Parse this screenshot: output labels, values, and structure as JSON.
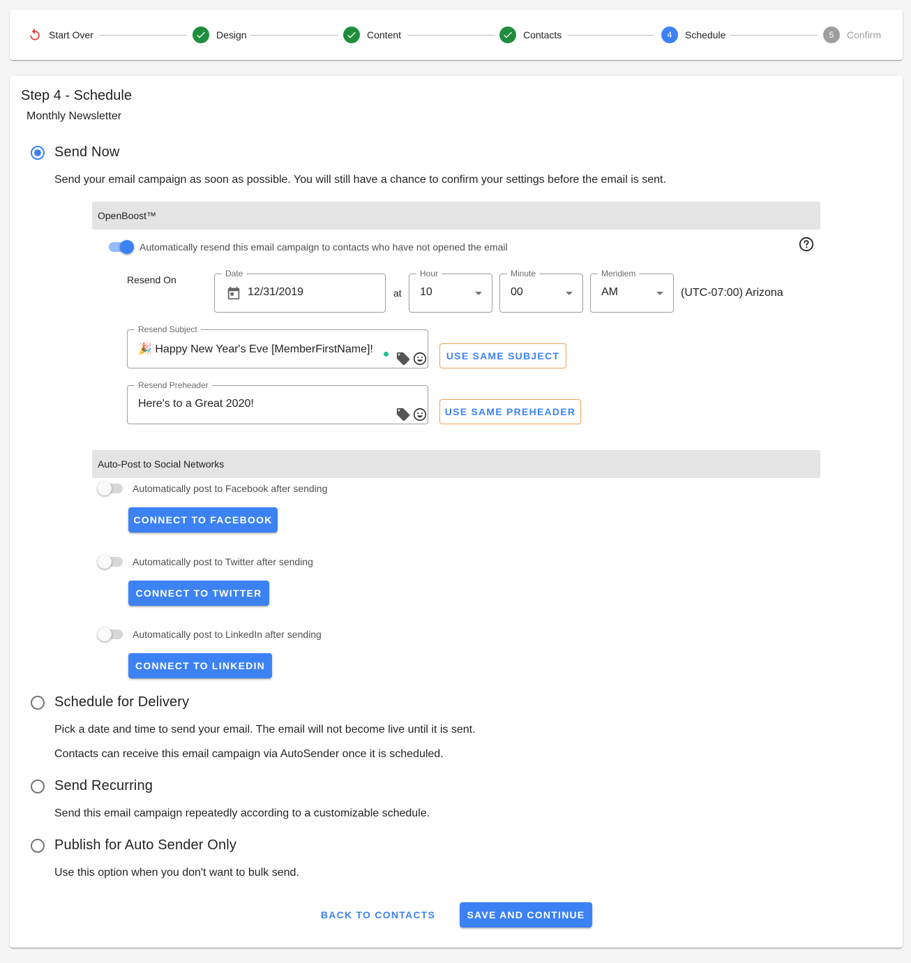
{
  "stepper": {
    "start_over": "Start Over",
    "steps": [
      {
        "label": "Design",
        "status": "done"
      },
      {
        "label": "Content",
        "status": "done"
      },
      {
        "label": "Contacts",
        "status": "done"
      },
      {
        "label": "Schedule",
        "number": "4",
        "status": "active"
      },
      {
        "label": "Confirm",
        "number": "5",
        "status": "future"
      }
    ]
  },
  "page": {
    "title": "Step 4 - Schedule",
    "subtitle": "Monthly Newsletter"
  },
  "options": {
    "send_now": {
      "title": "Send Now",
      "description": "Send your email campaign as soon as possible. You will still have a chance to confirm your settings before the email is sent.",
      "selected": true
    },
    "schedule": {
      "title": "Schedule for Delivery",
      "description": "Pick a date and time to send your email. The email will not become live until it is sent.",
      "description2": "Contacts can receive this email campaign via AutoSender once it is scheduled.",
      "selected": false
    },
    "recurring": {
      "title": "Send Recurring",
      "description": "Send this email campaign repeatedly according to a customizable schedule.",
      "selected": false
    },
    "autosender": {
      "title": "Publish for Auto Sender Only",
      "description": "Use this option when you don't want to bulk send.",
      "selected": false
    }
  },
  "openboost": {
    "header": "OpenBoost™",
    "toggle_label": "Automatically resend this email campaign to contacts who have not opened the email",
    "toggle_on": true,
    "resend_on_label": "Resend On",
    "date": {
      "legend": "Date",
      "value": "12/31/2019"
    },
    "at_label": "at",
    "hour": {
      "legend": "Hour",
      "value": "10"
    },
    "minute": {
      "legend": "Minute",
      "value": "00"
    },
    "meridiem": {
      "legend": "Meridiem",
      "value": "AM"
    },
    "timezone": "(UTC-07:00) Arizona",
    "subject": {
      "legend": "Resend Subject",
      "value": "🎉 Happy New Year's Eve [MemberFirstName]!"
    },
    "use_same_subject": "USE SAME SUBJECT",
    "preheader": {
      "legend": "Resend Preheader",
      "value": "Here's to a Great 2020!"
    },
    "use_same_preheader": "USE SAME PREHEADER"
  },
  "social": {
    "header": "Auto-Post to Social Networks",
    "items": [
      {
        "label": "Automatically post to Facebook after sending",
        "button": "CONNECT TO FACEBOOK",
        "on": false
      },
      {
        "label": "Automatically post to Twitter after sending",
        "button": "CONNECT TO TWITTER",
        "on": false
      },
      {
        "label": "Automatically post to LinkedIn after sending",
        "button": "CONNECT TO LINKEDIN",
        "on": false
      }
    ]
  },
  "footer": {
    "back": "BACK TO CONTACTS",
    "save": "SAVE AND CONTINUE"
  },
  "colors": {
    "primary": "#3c82f5",
    "done": "#1e8e3e",
    "outline_orange": "#f2a154"
  },
  "icons": [
    "restart-icon",
    "check-icon",
    "help-circle-icon",
    "calendar-icon",
    "tag-icon",
    "emoji-icon",
    "dropdown-caret-icon"
  ]
}
